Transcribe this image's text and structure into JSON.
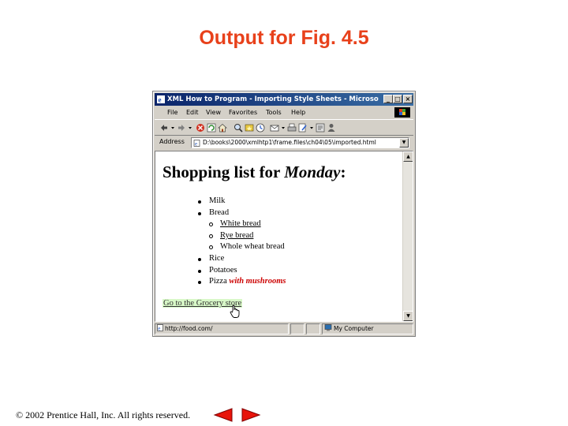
{
  "slide": {
    "title": "Output for Fig. 4.5",
    "copyright": "© 2002 Prentice Hall, Inc.  All rights reserved."
  },
  "window": {
    "title": "XML How to Program - Importing Style Sheets - Microsoft Int...",
    "controls": [
      "_",
      "□",
      "×"
    ]
  },
  "menu": [
    "File",
    "Edit",
    "View",
    "Favorites",
    "Tools",
    "Help"
  ],
  "toolbar_icons": [
    "back-icon",
    "forward-icon",
    "stop-icon",
    "refresh-icon",
    "home-icon",
    "search-icon",
    "favorites-icon",
    "history-icon",
    "mail-icon",
    "print-icon",
    "edit-icon",
    "discuss-icon",
    "messenger-icon"
  ],
  "address": {
    "label": "Address",
    "value": "D:\\books\\2000\\xmlhtp1\\frame.files\\ch04\\05\\imported.html"
  },
  "page": {
    "heading_prefix": "Shopping list for ",
    "heading_day": "Monday",
    "heading_suffix": ":",
    "items": {
      "milk": "Milk",
      "bread": "Bread",
      "white_bread": "White bread",
      "rye_bread": "Rye bread",
      "whole_wheat": "Whole wheat bread",
      "rice": "Rice",
      "potatoes": "Potatoes",
      "pizza": "Pizza ",
      "pizza_emphasis": "with mushrooms"
    },
    "grocery_link": "Go to the Grocery store"
  },
  "status": {
    "url": "http://food.com/",
    "zone": "My Computer"
  },
  "colors": {
    "title": "#e8411b",
    "titlebar": "#0a246a",
    "emphasis": "#cc0000",
    "link_highlight": "#d8f8c8",
    "nav_arrow": "#e8140a"
  }
}
